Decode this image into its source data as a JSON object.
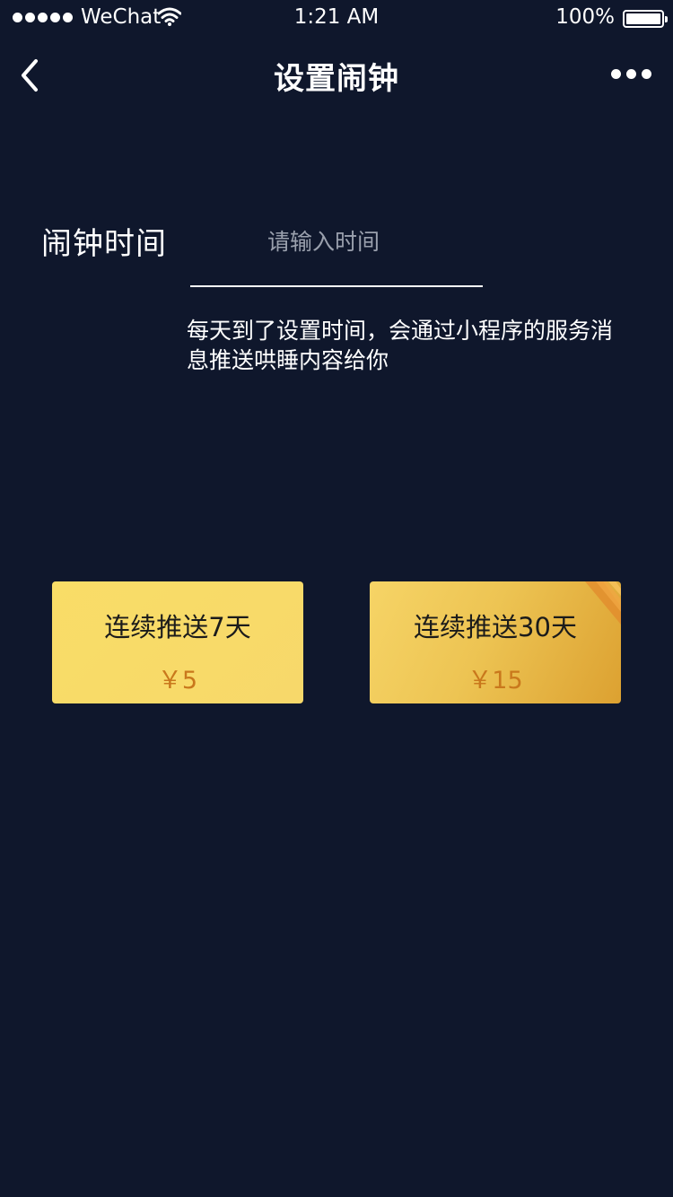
{
  "status_bar": {
    "carrier": "WeChat",
    "time": "1:21 AM",
    "battery": "100%"
  },
  "nav": {
    "title": "设置闹钟"
  },
  "form": {
    "label": "闹钟时间",
    "input_placeholder": "请输入时间",
    "input_value": "",
    "hint": "每天到了设置时间，会通过小程序的服务消息推送哄睡内容给你"
  },
  "plans": [
    {
      "title": "连续推送7天",
      "price": "￥5"
    },
    {
      "title": "连续推送30天",
      "price": "￥15"
    }
  ],
  "colors": {
    "background": "#0f172c",
    "card_gold": "#f9dd67",
    "price_text": "#c9781c"
  }
}
